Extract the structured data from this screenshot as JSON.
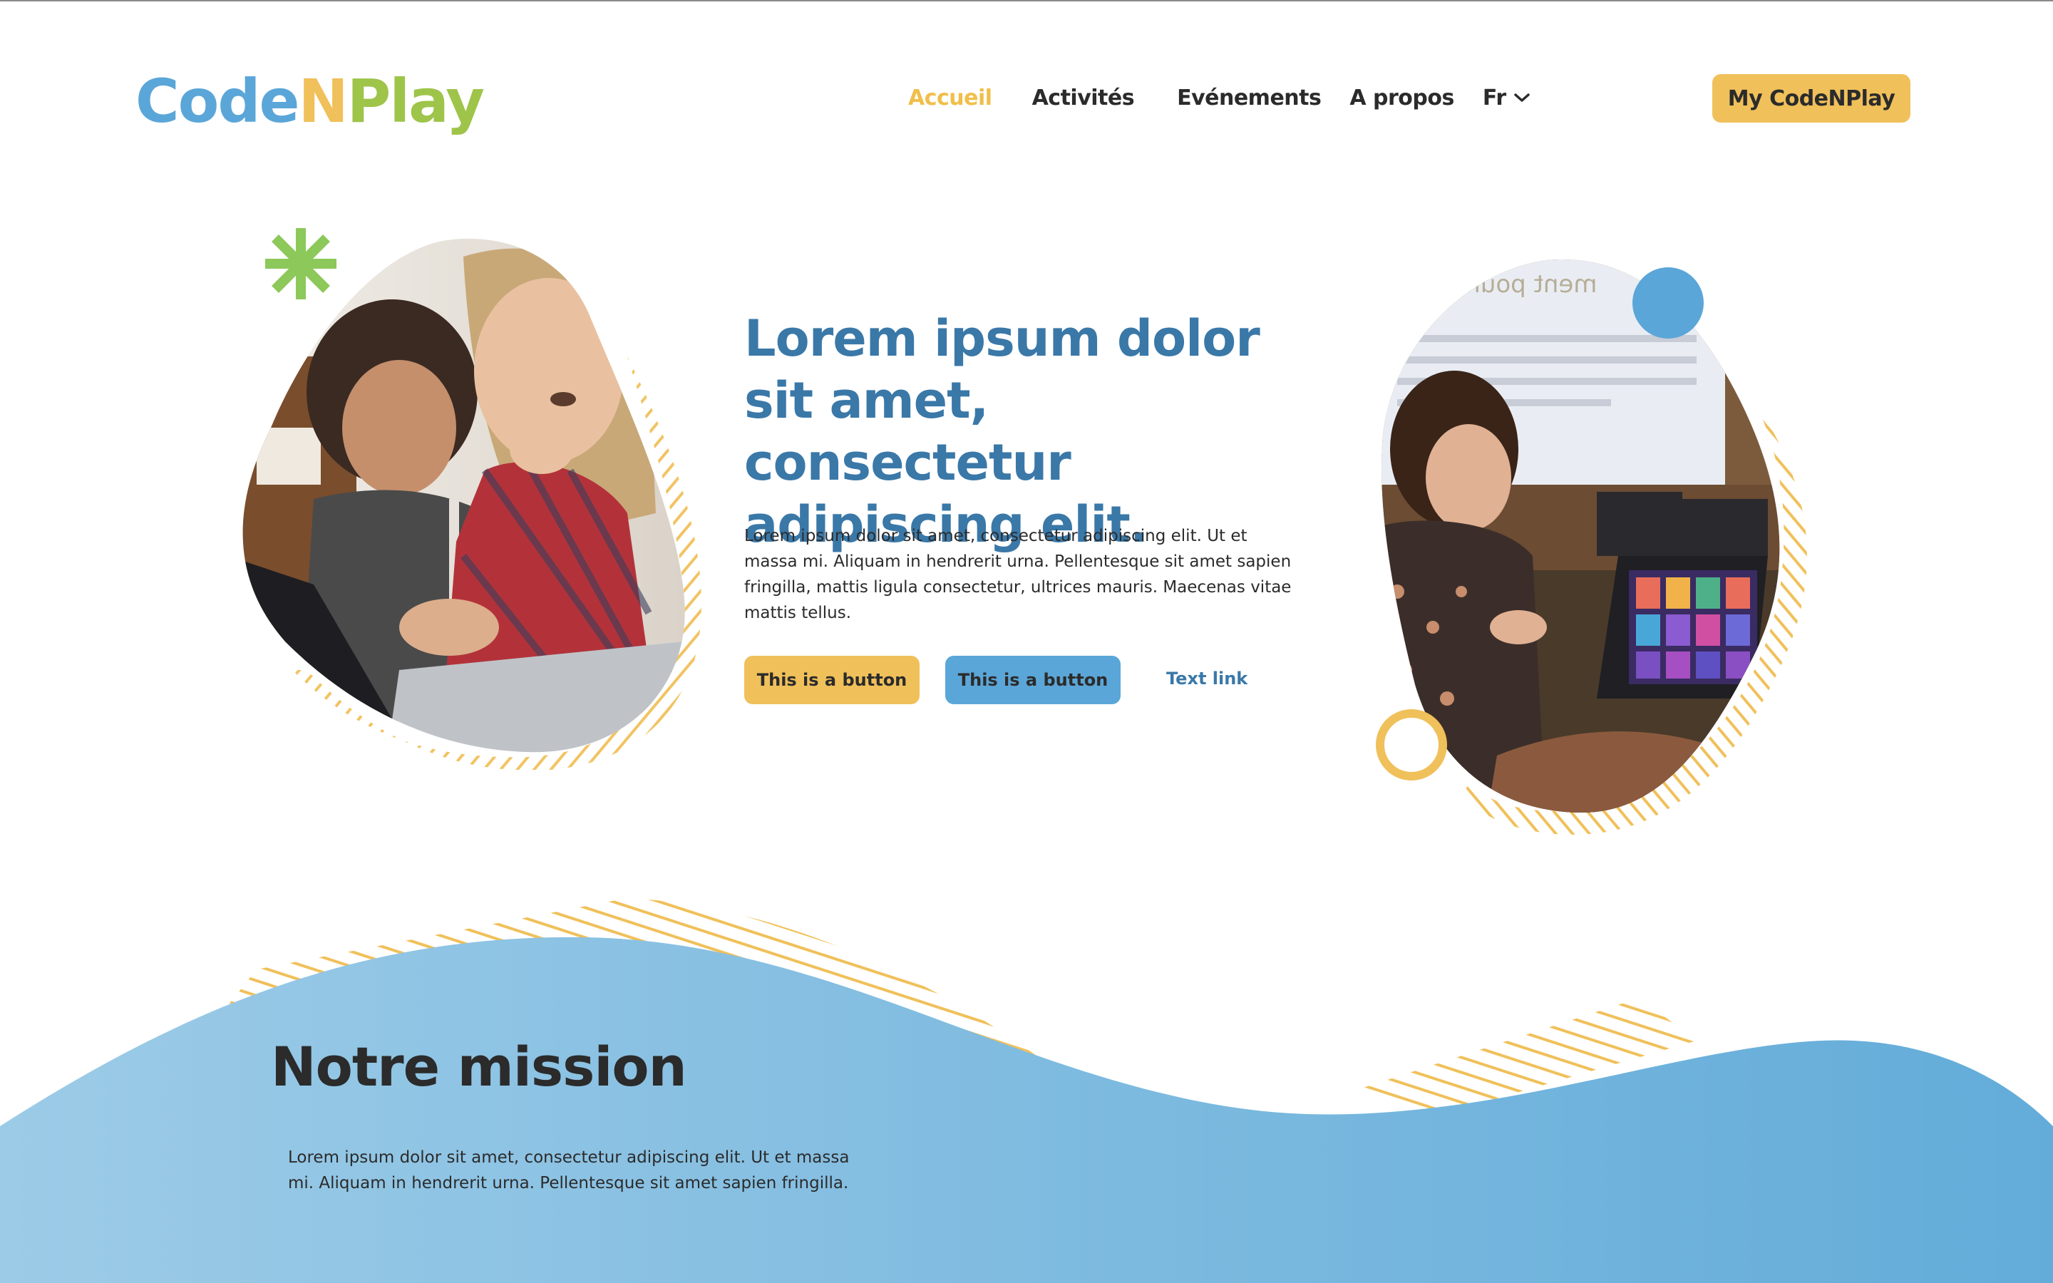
{
  "brand": {
    "parts": [
      "Code",
      "N",
      "Play"
    ],
    "colors": [
      "#5ba6d8",
      "#f0c05a",
      "#9ec44a"
    ]
  },
  "nav": {
    "items": [
      "Accueil",
      "Activités",
      "Evénements",
      "A propos"
    ],
    "active": "Accueil",
    "language": "Fr"
  },
  "account_button": "My CodeNPlay",
  "hero": {
    "title": "Lorem ipsum dolor sit amet, consectetur adipiscing elit.",
    "body": "Lorem ipsum dolor sit amet, consectetur adipiscing elit. Ut et massa mi. Aliquam in hendrerit urna. Pellentesque sit amet sapien fringilla, mattis ligula consectetur, ultrices mauris. Maecenas vitae mattis tellus.",
    "primary_button": "This is a button",
    "secondary_button": "This is a button",
    "text_link": "Text link",
    "projector_text": "ment pourrions"
  },
  "mission": {
    "title": "Notre mission",
    "body": "Lorem ipsum dolor sit amet, consectetur adipiscing elit. Ut et massa mi. Aliquam in hendrerit urna. Pellentesque sit amet sapien fringilla."
  },
  "colors": {
    "yellow": "#f0c05a",
    "blue": "#5ba6d8",
    "title_blue": "#3a78a8",
    "green": "#8cc85a",
    "text": "#2b2b2b"
  }
}
